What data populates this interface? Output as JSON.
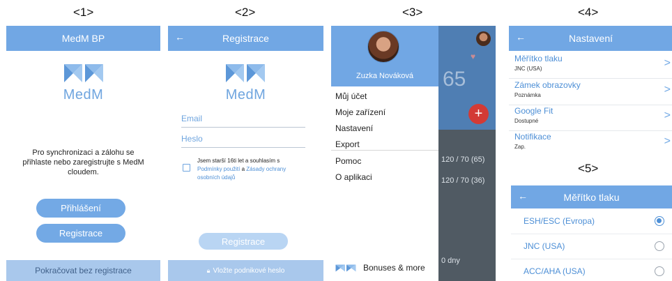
{
  "panel_numbers": [
    "<1>",
    "<2>",
    "<3>",
    "<4>",
    "<5>"
  ],
  "brand": {
    "name": "MedM"
  },
  "screen1": {
    "title": "MedM BP",
    "message_lines": [
      "Pro synchronizaci a zálohu se",
      "přihlaste nebo zaregistrujte s MedM",
      "cloudem."
    ],
    "login_button": "Přihlášení",
    "register_button": "Registrace",
    "skip_button": "Pokračovat bez registrace"
  },
  "screen2": {
    "title": "Registrace",
    "email_placeholder": "Email",
    "password_placeholder": "Heslo",
    "terms_line1": "Jsem starší 16ti let a souhlasím s",
    "terms_link1": "Podmínky použití",
    "terms_and": "a",
    "terms_link2a": "Zásady ochrany",
    "terms_link2b": "osobních údajů",
    "register_button": "Registrace",
    "corporate_link": "Vložte podnikové heslo",
    "terms_checked": false
  },
  "screen3": {
    "user_name": "Zuzka Nováková",
    "menu": [
      "Můj účet",
      "Moje zařízení",
      "Nastavení",
      "Export",
      "Pomoc",
      "O aplikaci"
    ],
    "bonus_label": "Bonuses & more",
    "background": {
      "big_value": "65",
      "readings": [
        "120 / 70 (65)",
        "120 / 70 (36)"
      ],
      "days": "0 dny"
    }
  },
  "screen4": {
    "title": "Nastavení",
    "settings": [
      {
        "title": "Měřítko tlaku",
        "value": "JNC (USA)"
      },
      {
        "title": "Zámek obrazovky",
        "value": "Poznámka"
      },
      {
        "title": "Google Fit",
        "value": "Dostupné"
      },
      {
        "title": "Notifikace",
        "value": "Zap."
      }
    ]
  },
  "screen5": {
    "title": "Měřítko tlaku",
    "options": [
      "ESH/ESC (Evropa)",
      "JNC (USA)",
      "ACC/AHA (USA)"
    ],
    "selected_index": 0
  },
  "colors": {
    "accent": "#71a7e4",
    "link": "#4d8fd6",
    "footer": "#a9c8ec",
    "add_button": "#d33a35"
  },
  "icons": [
    "back-arrow-icon",
    "medm-logo-icon",
    "lock-icon",
    "chevron-right-icon",
    "plus-icon",
    "heart-icon",
    "radio-icon",
    "bonus-logo-icon"
  ]
}
